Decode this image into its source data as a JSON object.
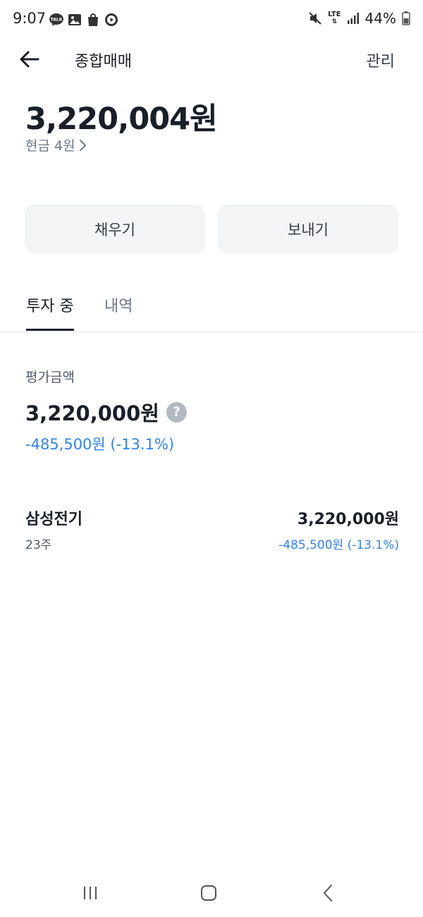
{
  "status_bar": {
    "time": "9:07",
    "kakao_badge": "TALK",
    "network": "LTE",
    "battery": "44%"
  },
  "header": {
    "title": "종합매매",
    "manage_label": "관리"
  },
  "account": {
    "balance": "3,220,004원",
    "cash_label": "현금 4원"
  },
  "actions": {
    "deposit_label": "채우기",
    "send_label": "보내기"
  },
  "tabs": [
    {
      "label": "투자 중",
      "active": true
    },
    {
      "label": "내역",
      "active": false
    }
  ],
  "evaluation": {
    "label": "평가금액",
    "amount": "3,220,000원",
    "change": "-485,500원 (-13.1%)"
  },
  "holdings": [
    {
      "name": "삼성전기",
      "quantity": "23주",
      "value": "3,220,000원",
      "change": "-485,500원 (-13.1%)"
    }
  ],
  "colors": {
    "accent_blue": "#3182f6",
    "button_bg": "#f2f4f6",
    "text_primary": "#191f28",
    "text_secondary": "#6b7684"
  }
}
